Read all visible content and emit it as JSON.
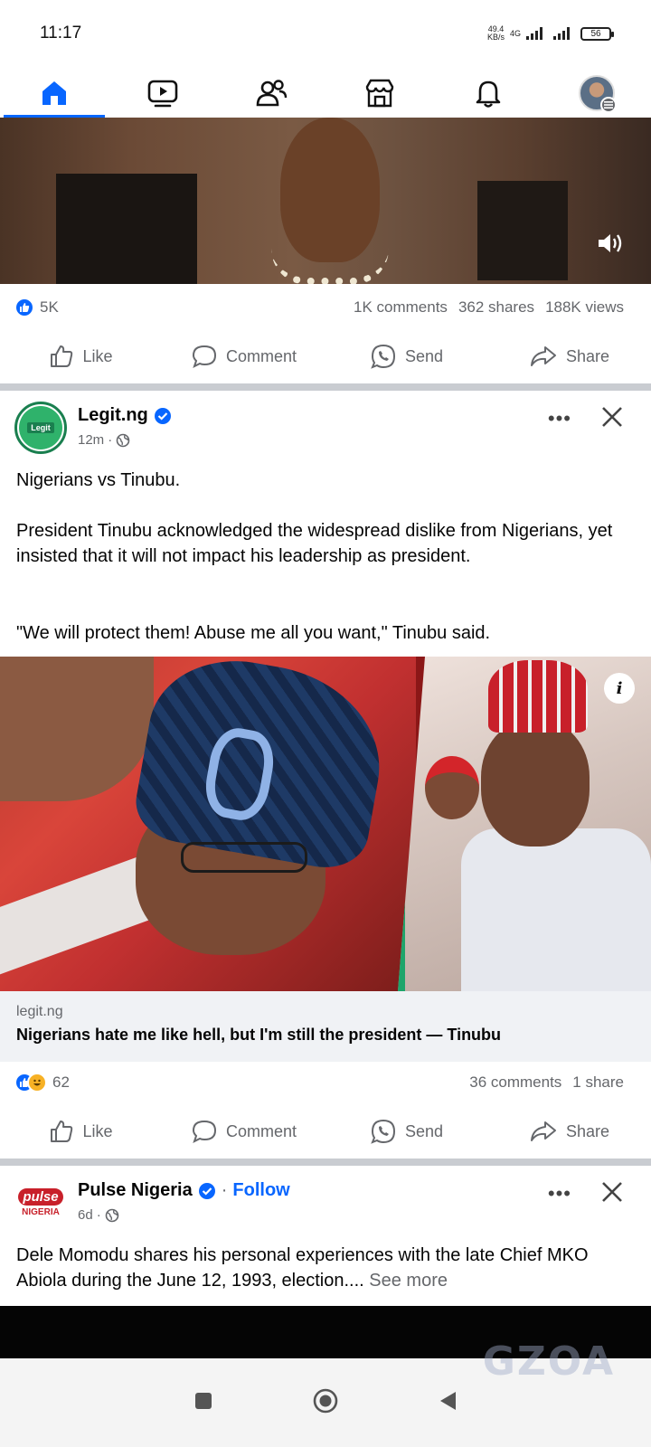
{
  "status_bar": {
    "time": "11:17",
    "net_speed_value": "49.4",
    "net_speed_unit": "KB/s",
    "network_type": "4G",
    "battery": "56"
  },
  "nav": {
    "items": [
      {
        "icon": "home-icon",
        "active": true
      },
      {
        "icon": "video-icon",
        "active": false
      },
      {
        "icon": "friends-icon",
        "active": false
      },
      {
        "icon": "marketplace-icon",
        "active": false
      },
      {
        "icon": "bell-icon",
        "active": false
      },
      {
        "icon": "profile-avatar",
        "active": false
      }
    ]
  },
  "video_post": {
    "reactions_count": "5K",
    "comments": "1K comments",
    "shares": "362 shares",
    "views": "188K views"
  },
  "actions": {
    "like": "Like",
    "comment": "Comment",
    "send": "Send",
    "share": "Share"
  },
  "legit_post": {
    "page_name": "Legit.ng",
    "avatar_text": "Legit",
    "time": "12m",
    "more": "•••",
    "text_1": "Nigerians vs Tinubu.",
    "text_2": "President Tinubu acknowledged the widespread dislike from Nigerians, yet insisted that it will not impact his leadership as president.",
    "text_3": "\"We will protect them! Abuse me all you want,\" Tinubu said.",
    "image_badge": "i",
    "link_domain": "legit.ng",
    "link_title": "Nigerians hate me like hell, but I'm still the president — Tinubu",
    "reactions_count": "62",
    "comments": "36 comments",
    "shares": "1 share"
  },
  "pulse_post": {
    "page_name": "Pulse Nigeria",
    "follow_separator": "·",
    "follow": "Follow",
    "avatar_text_1": "pulse",
    "avatar_text_2": "NIGERIA",
    "time": "6d",
    "more": "•••",
    "text": "Dele Momodu shares his personal experiences with the late Chief MKO Abiola during the June 12, 1993, election....",
    "see_more": "See more"
  },
  "watermark": "GZOA",
  "colors": {
    "accent": "#0866ff",
    "muted": "#65676b",
    "separator": "#c9ccd1",
    "legit_green": "#1a7f4f",
    "pulse_red": "#c8202a"
  }
}
